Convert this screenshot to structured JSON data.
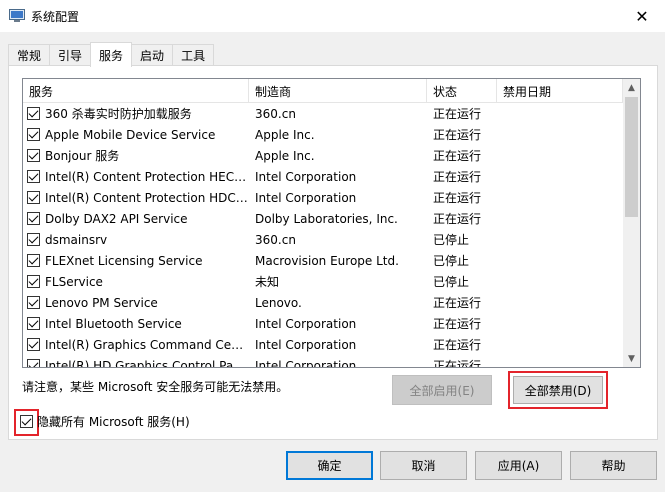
{
  "window": {
    "title": "系统配置",
    "close_label": "✕"
  },
  "tabs": [
    {
      "label": "常规",
      "active": false
    },
    {
      "label": "引导",
      "active": false
    },
    {
      "label": "服务",
      "active": true
    },
    {
      "label": "启动",
      "active": false
    },
    {
      "label": "工具",
      "active": false
    }
  ],
  "services": {
    "columns": [
      "服务",
      "制造商",
      "状态",
      "禁用日期"
    ],
    "rows": [
      {
        "checked": true,
        "name": "360 杀毒实时防护加载服务",
        "vendor": "360.cn",
        "status": "正在运行",
        "disabled_date": ""
      },
      {
        "checked": true,
        "name": "Apple Mobile Device Service",
        "vendor": "Apple Inc.",
        "status": "正在运行",
        "disabled_date": ""
      },
      {
        "checked": true,
        "name": "Bonjour 服务",
        "vendor": "Apple Inc.",
        "status": "正在运行",
        "disabled_date": ""
      },
      {
        "checked": true,
        "name": "Intel(R) Content Protection HECI ...",
        "vendor": "Intel Corporation",
        "status": "正在运行",
        "disabled_date": ""
      },
      {
        "checked": true,
        "name": "Intel(R) Content Protection HDCP...",
        "vendor": "Intel Corporation",
        "status": "正在运行",
        "disabled_date": ""
      },
      {
        "checked": true,
        "name": "Dolby DAX2 API Service",
        "vendor": "Dolby Laboratories, Inc.",
        "status": "正在运行",
        "disabled_date": ""
      },
      {
        "checked": true,
        "name": "dsmainsrv",
        "vendor": "360.cn",
        "status": "已停止",
        "disabled_date": ""
      },
      {
        "checked": true,
        "name": "FLEXnet Licensing Service",
        "vendor": "Macrovision Europe Ltd.",
        "status": "已停止",
        "disabled_date": ""
      },
      {
        "checked": true,
        "name": "FLService",
        "vendor": "未知",
        "status": "已停止",
        "disabled_date": ""
      },
      {
        "checked": true,
        "name": "Lenovo PM Service",
        "vendor": "Lenovo.",
        "status": "正在运行",
        "disabled_date": ""
      },
      {
        "checked": true,
        "name": "Intel Bluetooth Service",
        "vendor": "Intel Corporation",
        "status": "正在运行",
        "disabled_date": ""
      },
      {
        "checked": true,
        "name": "Intel(R) Graphics Command Cent...",
        "vendor": "Intel Corporation",
        "status": "正在运行",
        "disabled_date": ""
      },
      {
        "checked": true,
        "name": "Intel(R) HD Graphics Control Pan...",
        "vendor": "Intel Corporation",
        "status": "正在运行",
        "disabled_date": ""
      }
    ]
  },
  "notice": "请注意，某些 Microsoft 安全服务可能无法禁用。",
  "buttons": {
    "enable_all": "全部启用(E)",
    "disable_all": "全部禁用(D)",
    "ok": "确定",
    "cancel": "取消",
    "apply": "应用(A)",
    "help": "帮助"
  },
  "hide_ms": {
    "label": "隐藏所有 Microsoft 服务(H)",
    "checked": true
  },
  "colors": {
    "highlight_box": "#e3242b",
    "primary_border": "#0078d7"
  }
}
